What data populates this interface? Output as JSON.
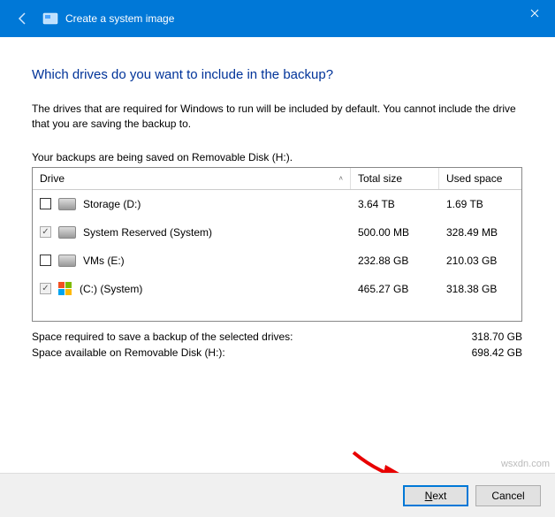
{
  "titlebar": {
    "title": "Create a system image"
  },
  "content": {
    "heading": "Which drives do you want to include in the backup?",
    "description": "The drives that are required for Windows to run will be included by default. You cannot include the drive that you are saving the backup to.",
    "saving_info": "Your backups are being saved on Removable Disk (H:)."
  },
  "grid": {
    "headers": {
      "drive": "Drive",
      "total": "Total size",
      "used": "Used space"
    },
    "rows": [
      {
        "checked": false,
        "disabled": false,
        "icon": "hdd",
        "name": "Storage (D:)",
        "total": "3.64 TB",
        "used": "1.69 TB"
      },
      {
        "checked": true,
        "disabled": true,
        "icon": "hdd",
        "name": "System Reserved (System)",
        "total": "500.00 MB",
        "used": "328.49 MB"
      },
      {
        "checked": false,
        "disabled": false,
        "icon": "hdd",
        "name": "VMs (E:)",
        "total": "232.88 GB",
        "used": "210.03 GB"
      },
      {
        "checked": true,
        "disabled": true,
        "icon": "win",
        "name": "(C:) (System)",
        "total": "465.27 GB",
        "used": "318.38 GB"
      }
    ]
  },
  "summary": {
    "required_label": "Space required to save a backup of the selected drives:",
    "required_value": "318.70 GB",
    "available_label": "Space available on Removable Disk (H:):",
    "available_value": "698.42 GB"
  },
  "footer": {
    "next": "Next",
    "cancel": "Cancel"
  },
  "watermark": "wsxdn.com"
}
